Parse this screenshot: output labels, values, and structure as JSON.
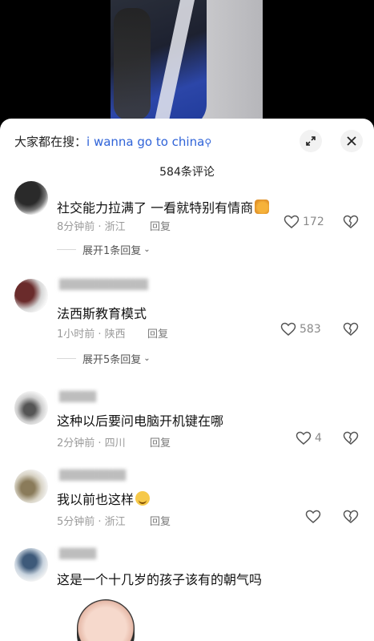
{
  "video": {},
  "header": {
    "hint_prefix": "大家都在搜：",
    "hint_query": "i wanna go to china",
    "search_icon_glyph": "⚲",
    "expand_icon": "expand-icon",
    "close_icon": "close-icon"
  },
  "comment_count": "584条评论",
  "comments": [
    {
      "text": "社交能力拉满了 一看就特别有情商",
      "meta": "8分钟前 · 浙江",
      "reply_label": "回复",
      "likes": "172",
      "expand": "展开1条回复"
    },
    {
      "text": "法西斯教育模式",
      "meta": "1小时前 · 陕西",
      "reply_label": "回复",
      "likes": "583",
      "expand": "展开5条回复"
    },
    {
      "text": "这种以后要问电脑开机键在哪",
      "meta": "2分钟前 · 四川",
      "reply_label": "回复",
      "likes": "4"
    },
    {
      "text": "我以前也这样",
      "meta": "5分钟前 · 浙江",
      "reply_label": "回复",
      "likes": ""
    },
    {
      "text": "这是一个十几岁的孩子该有的朝气吗"
    }
  ]
}
